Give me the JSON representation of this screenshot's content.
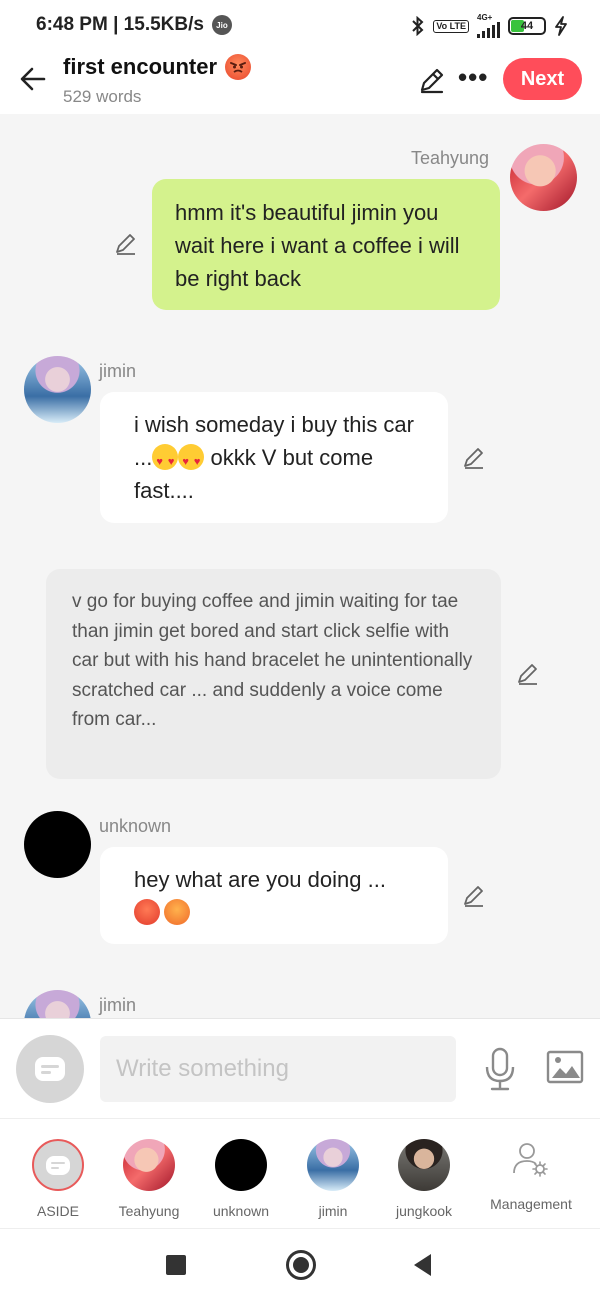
{
  "status_bar": {
    "time_speed": "6:48 PM | 15.5KB/s",
    "carrier_badge": "Jio",
    "network": "4G+",
    "volte": "Vo LTE",
    "battery_level": "44",
    "battery_percent": 44,
    "battery_color": "#39c33d"
  },
  "header": {
    "title": "first encounter",
    "word_count": "529 words",
    "next_label": "Next",
    "accent_color": "#ff4d5a"
  },
  "messages": [
    {
      "type": "right",
      "speaker": "Teahyung",
      "text": "hmm it's beautiful jimin you wait here i want a coffee i will be right back",
      "bubble_color": "#d4f28d"
    },
    {
      "type": "left",
      "speaker": "jimin",
      "text_before": "i wish someday i buy this car ...",
      "emojis": [
        "heart-eyes",
        "heart-eyes"
      ],
      "text_after": " okkk V but come fast...."
    },
    {
      "type": "aside",
      "text": "v go for buying coffee and jimin waiting for tae than jimin get bored and  start click selfie with car but with his hand bracelet he unintentionally scratched car  ... and suddenly a voice come from car..."
    },
    {
      "type": "left",
      "speaker": "unknown",
      "text": "hey what are you doing ...",
      "emojis": [
        "angry-face",
        "angry-face"
      ]
    },
    {
      "type": "left",
      "speaker": "jimin"
    }
  ],
  "input": {
    "placeholder": "Write something"
  },
  "roles": [
    {
      "label": "ASIDE",
      "icon": "aside-icon",
      "selected": true
    },
    {
      "label": "Teahyung",
      "icon": "teahyung-avatar"
    },
    {
      "label": "unknown",
      "icon": "unknown-avatar"
    },
    {
      "label": "jimin",
      "icon": "jimin-avatar"
    },
    {
      "label": "jungkook",
      "icon": "jungkook-avatar"
    },
    {
      "label": "Management",
      "icon": "management-icon"
    }
  ]
}
